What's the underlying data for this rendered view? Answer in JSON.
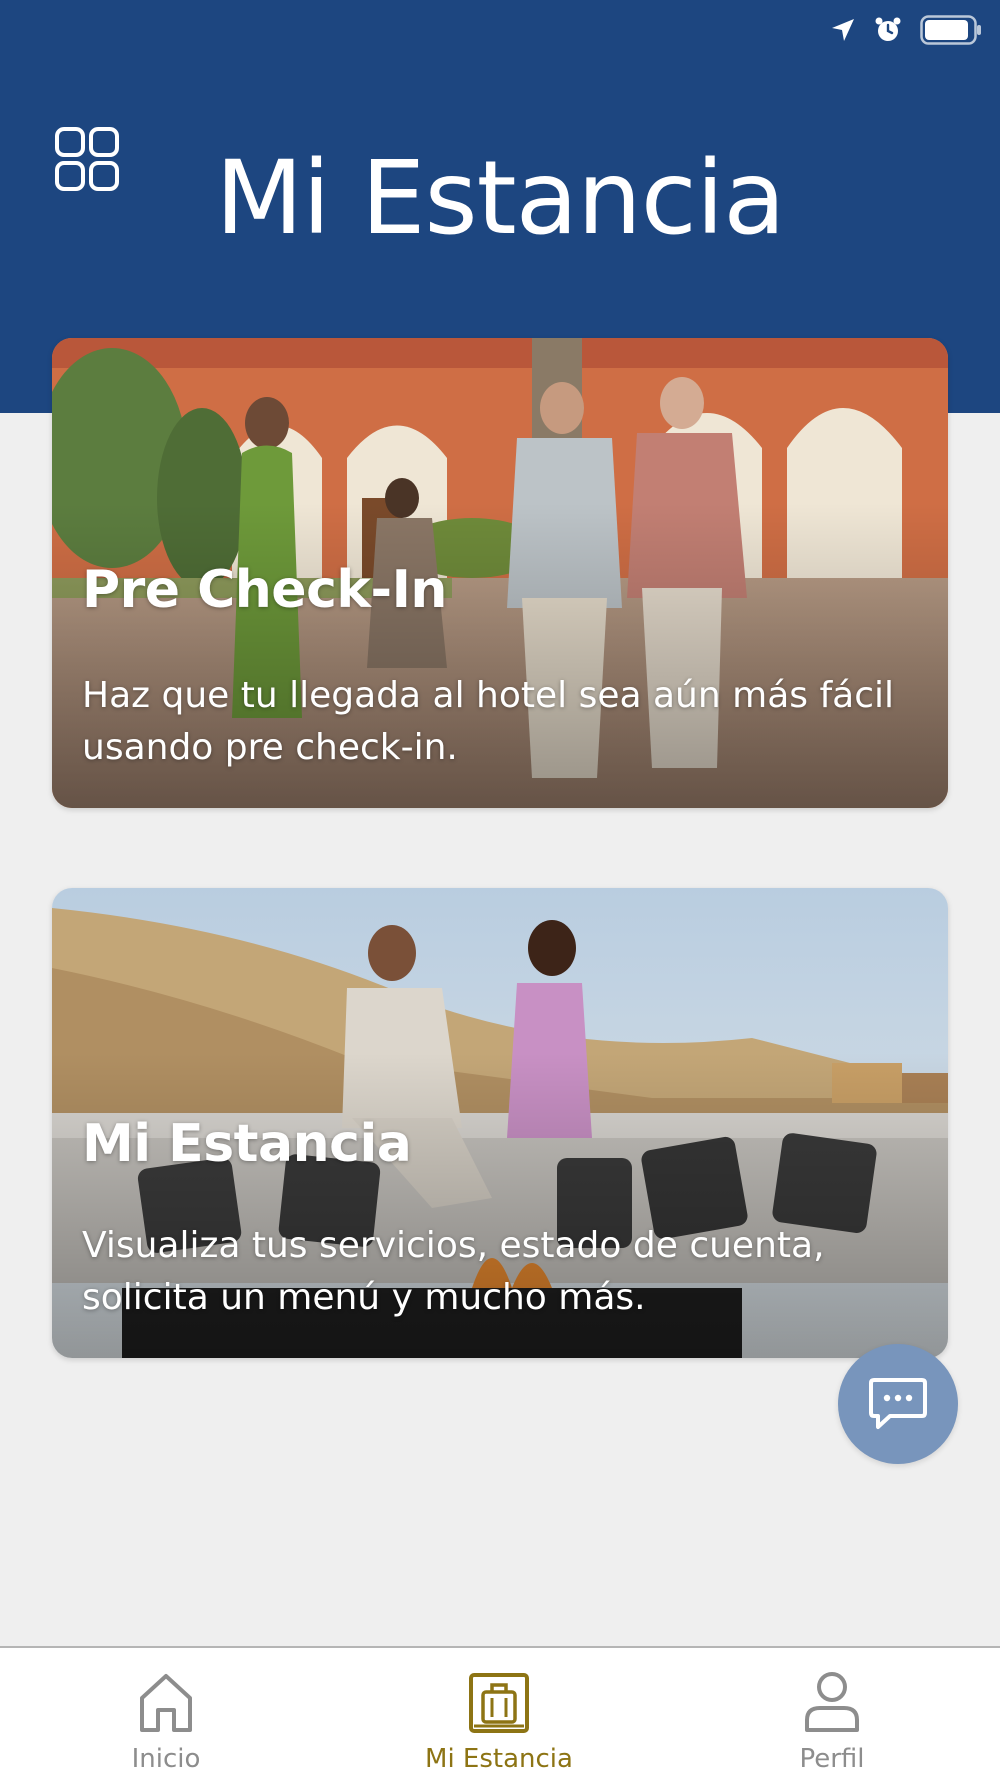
{
  "header": {
    "title": "Mi Estancia",
    "menu_icon": "grid-icon",
    "background_color": "#1d4680"
  },
  "status_bar": {
    "icons": [
      "location-arrow-icon",
      "alarm-clock-icon",
      "battery-icon"
    ]
  },
  "cards": [
    {
      "title": "Pre Check-In",
      "description": "Haz que tu llegada al hotel sea aún más fácil usando pre check-in."
    },
    {
      "title": "Mi Estancia",
      "description": "Visualiza tus servicios, estado de cuenta, solicita un menú y mucho más."
    }
  ],
  "chat_button": {
    "icon": "chat-bubble-icon",
    "color": "#7895bc"
  },
  "bottom_nav": {
    "items": [
      {
        "label": "Inicio",
        "icon": "home-icon",
        "active": false
      },
      {
        "label": "Mi Estancia",
        "icon": "luggage-icon",
        "active": true
      },
      {
        "label": "Perfil",
        "icon": "person-icon",
        "active": false
      }
    ],
    "active_color": "#8d7414",
    "inactive_color": "#8d8d8d"
  }
}
